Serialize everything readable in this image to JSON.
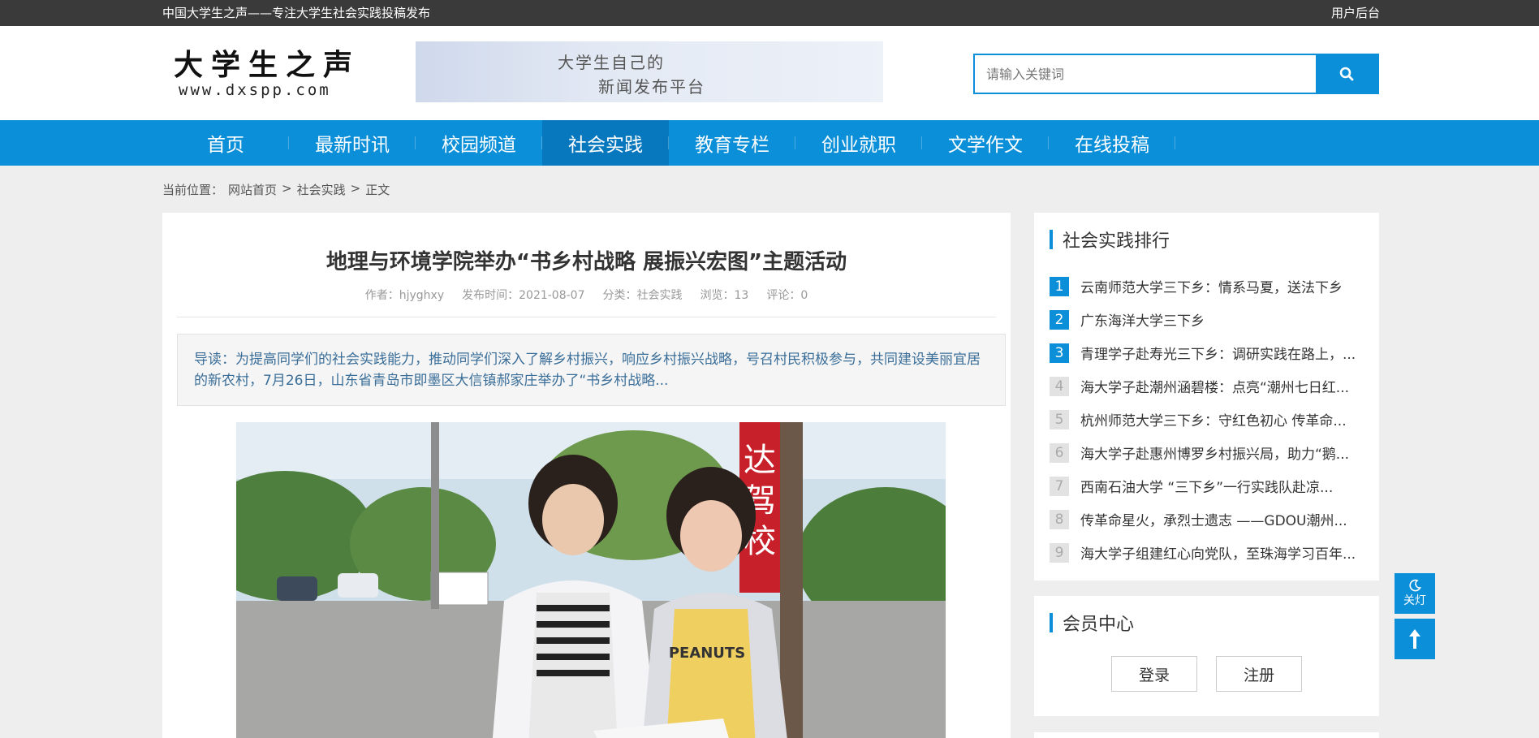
{
  "topbar": {
    "slogan": "中国大学生之声——专注大学生社会实践投稿发布",
    "admin_link": "用户后台"
  },
  "header": {
    "logo_cn": "大学生之声",
    "logo_en": "www.dxspp.com",
    "banner_line1": "大学生自己的",
    "banner_line2": "新闻发布平台",
    "search_placeholder": "请输入关键词",
    "search_icon": "search-icon"
  },
  "nav": {
    "items": [
      {
        "label": "首页"
      },
      {
        "label": "最新时讯"
      },
      {
        "label": "校园频道"
      },
      {
        "label": "社会实践",
        "active": true
      },
      {
        "label": "教育专栏"
      },
      {
        "label": "创业就职"
      },
      {
        "label": "文学作文"
      },
      {
        "label": "在线投稿"
      }
    ]
  },
  "breadcrumb": {
    "prefix": "当前位置：",
    "home": "网站首页",
    "sep": ">",
    "category": "社会实践",
    "current": "正文"
  },
  "article": {
    "title": "地理与环境学院举办“书乡村战略 展振兴宏图”主题活动",
    "meta": {
      "author": "作者：hjyghxy",
      "date": "发布时间：2021-08-07",
      "category": "分类：社会实践",
      "views": "浏览：13",
      "comments": "评论：0"
    },
    "summary": "导读：为提高同学们的社会实践能力，推动同学们深入了解乡村振兴，响应乡村振兴战略，号召村民积极参与，共同建设美丽宜居的新农村，7月26日，山东省青岛市即墨区大信镇郝家庄举办了“书乡村战略..."
  },
  "ranking": {
    "title": "社会实践排行",
    "items": [
      {
        "num": "1",
        "title": "云南师范大学三下乡：情系马夏，送法下乡"
      },
      {
        "num": "2",
        "title": "广东海洋大学三下乡"
      },
      {
        "num": "3",
        "title": "青理学子赴寿光三下乡：调研实践在路上，..."
      },
      {
        "num": "4",
        "title": "海大学子赴潮州涵碧楼：点亮“潮州七日红..."
      },
      {
        "num": "5",
        "title": "杭州师范大学三下乡：守红色初心 传革命..."
      },
      {
        "num": "6",
        "title": "海大学子赴惠州博罗乡村振兴局，助力“鹅..."
      },
      {
        "num": "7",
        "title": "西南石油大学 “三下乡”一行实践队赴凉..."
      },
      {
        "num": "8",
        "title": "传革命星火，承烈士遗志 ——GDOU潮州..."
      },
      {
        "num": "9",
        "title": "海大学子组建红心向党队，至珠海学习百年..."
      }
    ]
  },
  "member": {
    "title": "会员中心",
    "login": "登录",
    "register": "注册"
  },
  "floating": {
    "light_label": "关灯",
    "moon_icon": "moon-icon",
    "top_icon": "arrow-up-icon"
  },
  "colors": {
    "accent": "#0b8fd8",
    "topbar": "#3a3a3a",
    "nav_active": "#0878be",
    "summary_text": "#3a6e99"
  }
}
